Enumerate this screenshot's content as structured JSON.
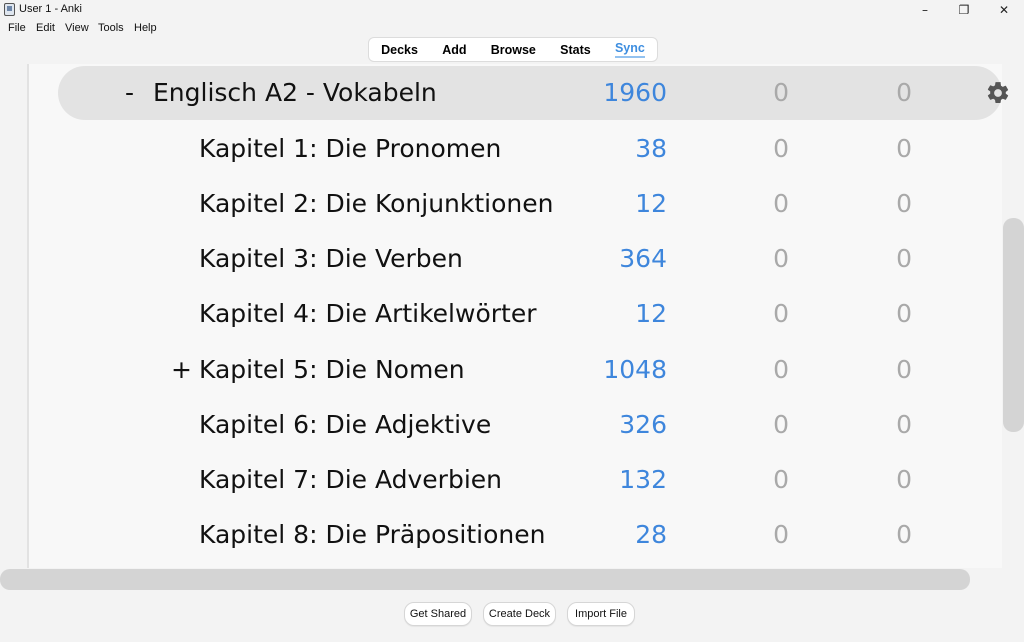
{
  "window": {
    "title": "User 1 - Anki",
    "minimize": "–",
    "maximize": "❐",
    "close": "✕"
  },
  "menu": {
    "items": [
      "File",
      "Edit",
      "View",
      "Tools",
      "Help"
    ]
  },
  "toolbar": {
    "items": [
      "Decks",
      "Add",
      "Browse",
      "Stats",
      "Sync"
    ],
    "active": "Sync"
  },
  "decks": [
    {
      "prefix": "-",
      "name": "Englisch A2 - Vokabeln",
      "new": "1960",
      "learn": "0",
      "due": "0",
      "current": true
    },
    {
      "prefix": "",
      "name": "Kapitel 1: Die Pronomen",
      "new": "38",
      "learn": "0",
      "due": "0"
    },
    {
      "prefix": "",
      "name": "Kapitel 2: Die Konjunktionen",
      "new": "12",
      "learn": "0",
      "due": "0"
    },
    {
      "prefix": "",
      "name": "Kapitel 3: Die Verben",
      "new": "364",
      "learn": "0",
      "due": "0"
    },
    {
      "prefix": "",
      "name": "Kapitel 4: Die Artikelwörter",
      "new": "12",
      "learn": "0",
      "due": "0"
    },
    {
      "prefix": "+",
      "name": "Kapitel 5: Die Nomen",
      "new": "1048",
      "learn": "0",
      "due": "0"
    },
    {
      "prefix": "",
      "name": "Kapitel 6: Die Adjektive",
      "new": "326",
      "learn": "0",
      "due": "0"
    },
    {
      "prefix": "",
      "name": "Kapitel 7: Die Adverbien",
      "new": "132",
      "learn": "0",
      "due": "0"
    },
    {
      "prefix": "",
      "name": "Kapitel 8: Die Präpositionen",
      "new": "28",
      "learn": "0",
      "due": "0"
    }
  ],
  "bottom_buttons": {
    "get_shared": "Get Shared",
    "create_deck": "Create Deck",
    "import_file": "Import File"
  },
  "colors": {
    "new_count": "#3e86dc",
    "zero_count": "#a9a9a9",
    "active_tab": "#3e8ee0"
  },
  "icons": {
    "options": "gear-icon"
  }
}
